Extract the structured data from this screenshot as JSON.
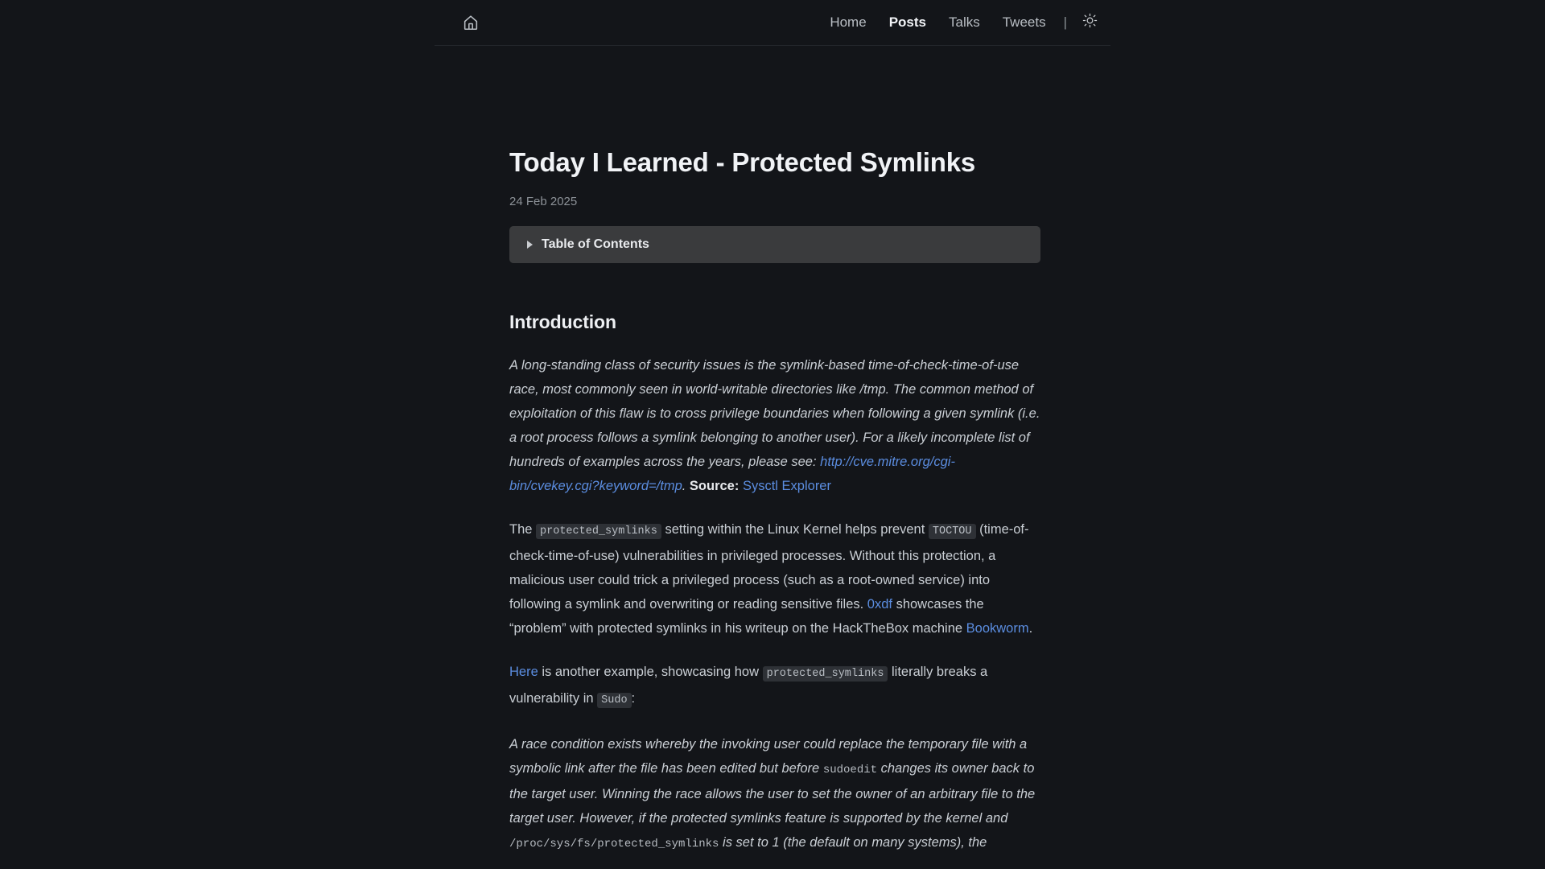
{
  "header": {
    "home_icon": "home-icon",
    "nav": [
      {
        "label": "Home",
        "active": false
      },
      {
        "label": "Posts",
        "active": true
      },
      {
        "label": "Talks",
        "active": false
      },
      {
        "label": "Tweets",
        "active": false
      }
    ],
    "separator": "|",
    "theme_toggle_icon": "sun-icon"
  },
  "post": {
    "title": "Today I Learned - Protected Symlinks",
    "date": "24 Feb 2025",
    "toc_label": "Table of Contents",
    "toc_marker": "triangle-right-icon"
  },
  "sections": {
    "introduction_heading": "Introduction"
  },
  "quote1": {
    "part1": "A long-standing class of security issues is the symlink-based time-of-check-time-of-use race, most commonly seen in world-writable directories like /tmp. The common method of exploitation of this flaw is to cross privilege boundaries when following a given symlink (i.e. a root process follows a symlink belonging to another user). For a likely incomplete list of hundreds of examples across the years, please see: ",
    "link_text": "http://cve.mitre.org/cgi-bin/cvekey.cgi?keyword=/tmp",
    "part2": ". ",
    "source_label": "Source:",
    "source_link": "Sysctl Explorer"
  },
  "para1": {
    "t1": "The ",
    "code1": "protected_symlinks",
    "t2": " setting within the Linux Kernel helps prevent ",
    "code2": "TOCTOU",
    "t3": " (time-of-check-time-of-use) vulnerabilities in privileged processes. Without this protection, a malicious user could trick a privileged process (such as a root-owned service) into following a symlink and overwriting or reading sensitive files. ",
    "link1": "0xdf",
    "t4": " showcases the “problem” with protected symlinks in his writeup on the HackTheBox machine ",
    "link2": "Bookworm",
    "t5": "."
  },
  "para2": {
    "link1": "Here",
    "t1": " is another example, showcasing how ",
    "code1": "protected_symlinks",
    "t2": " literally breaks a vulnerability in ",
    "code2": "Sudo",
    "t3": ":"
  },
  "quote2": {
    "t1": "A race condition exists whereby the invoking user could replace the temporary file with a symbolic link after the file has been edited but before ",
    "code1": "sudoedit",
    "t2": " changes its owner back to the target user. Winning the race allows the user to set the owner of an arbitrary file to the target user. However, if the protected symlinks feature is supported by the kernel and ",
    "code2": "/proc/sys/fs/protected_symlinks",
    "t3": " is set to 1 (the default on many systems), the"
  },
  "colors": {
    "background": "#131519",
    "text": "#c9ced4",
    "heading": "#f1f3f6",
    "link": "#5b8de0",
    "toc_background": "#3a3b3d",
    "code_chip_background": "#2e3136",
    "muted": "#8d9298"
  }
}
